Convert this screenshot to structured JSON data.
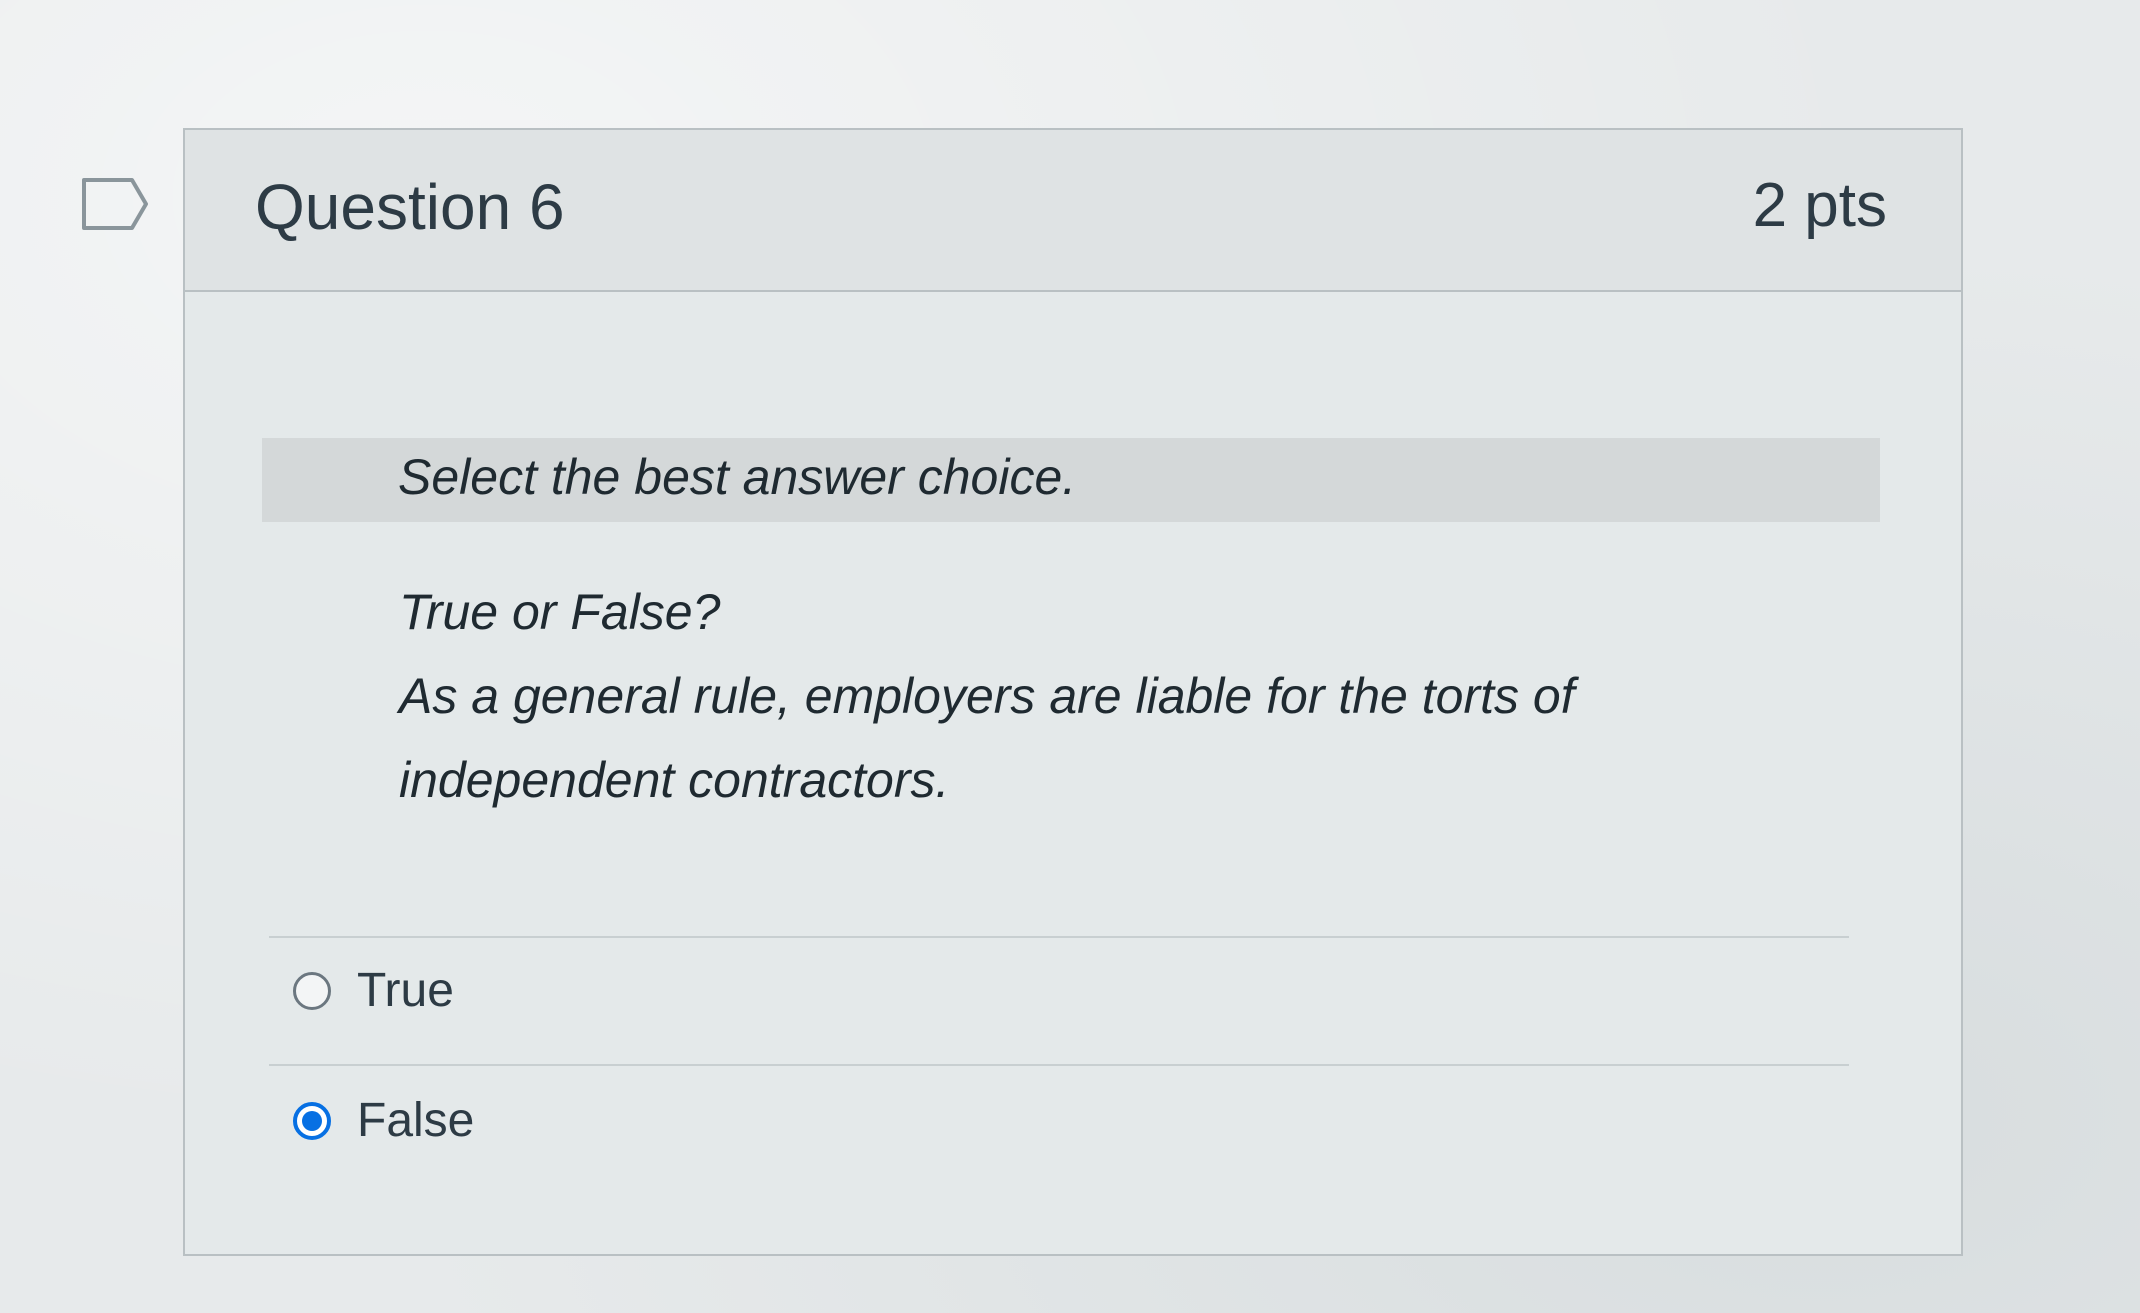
{
  "question": {
    "title": "Question 6",
    "points": "2 pts",
    "flag_icon": "flag-outline-icon"
  },
  "instruction": "Select the best answer choice.",
  "prompt": {
    "line1": "True or False?",
    "line2": "As a general rule, employers are liable for the torts of",
    "line3": "independent contractors."
  },
  "answers": [
    {
      "label": "True",
      "selected": false
    },
    {
      "label": "False",
      "selected": true
    }
  ],
  "colors": {
    "selected_radio": "#0770e3",
    "text": "#2d3b45"
  }
}
